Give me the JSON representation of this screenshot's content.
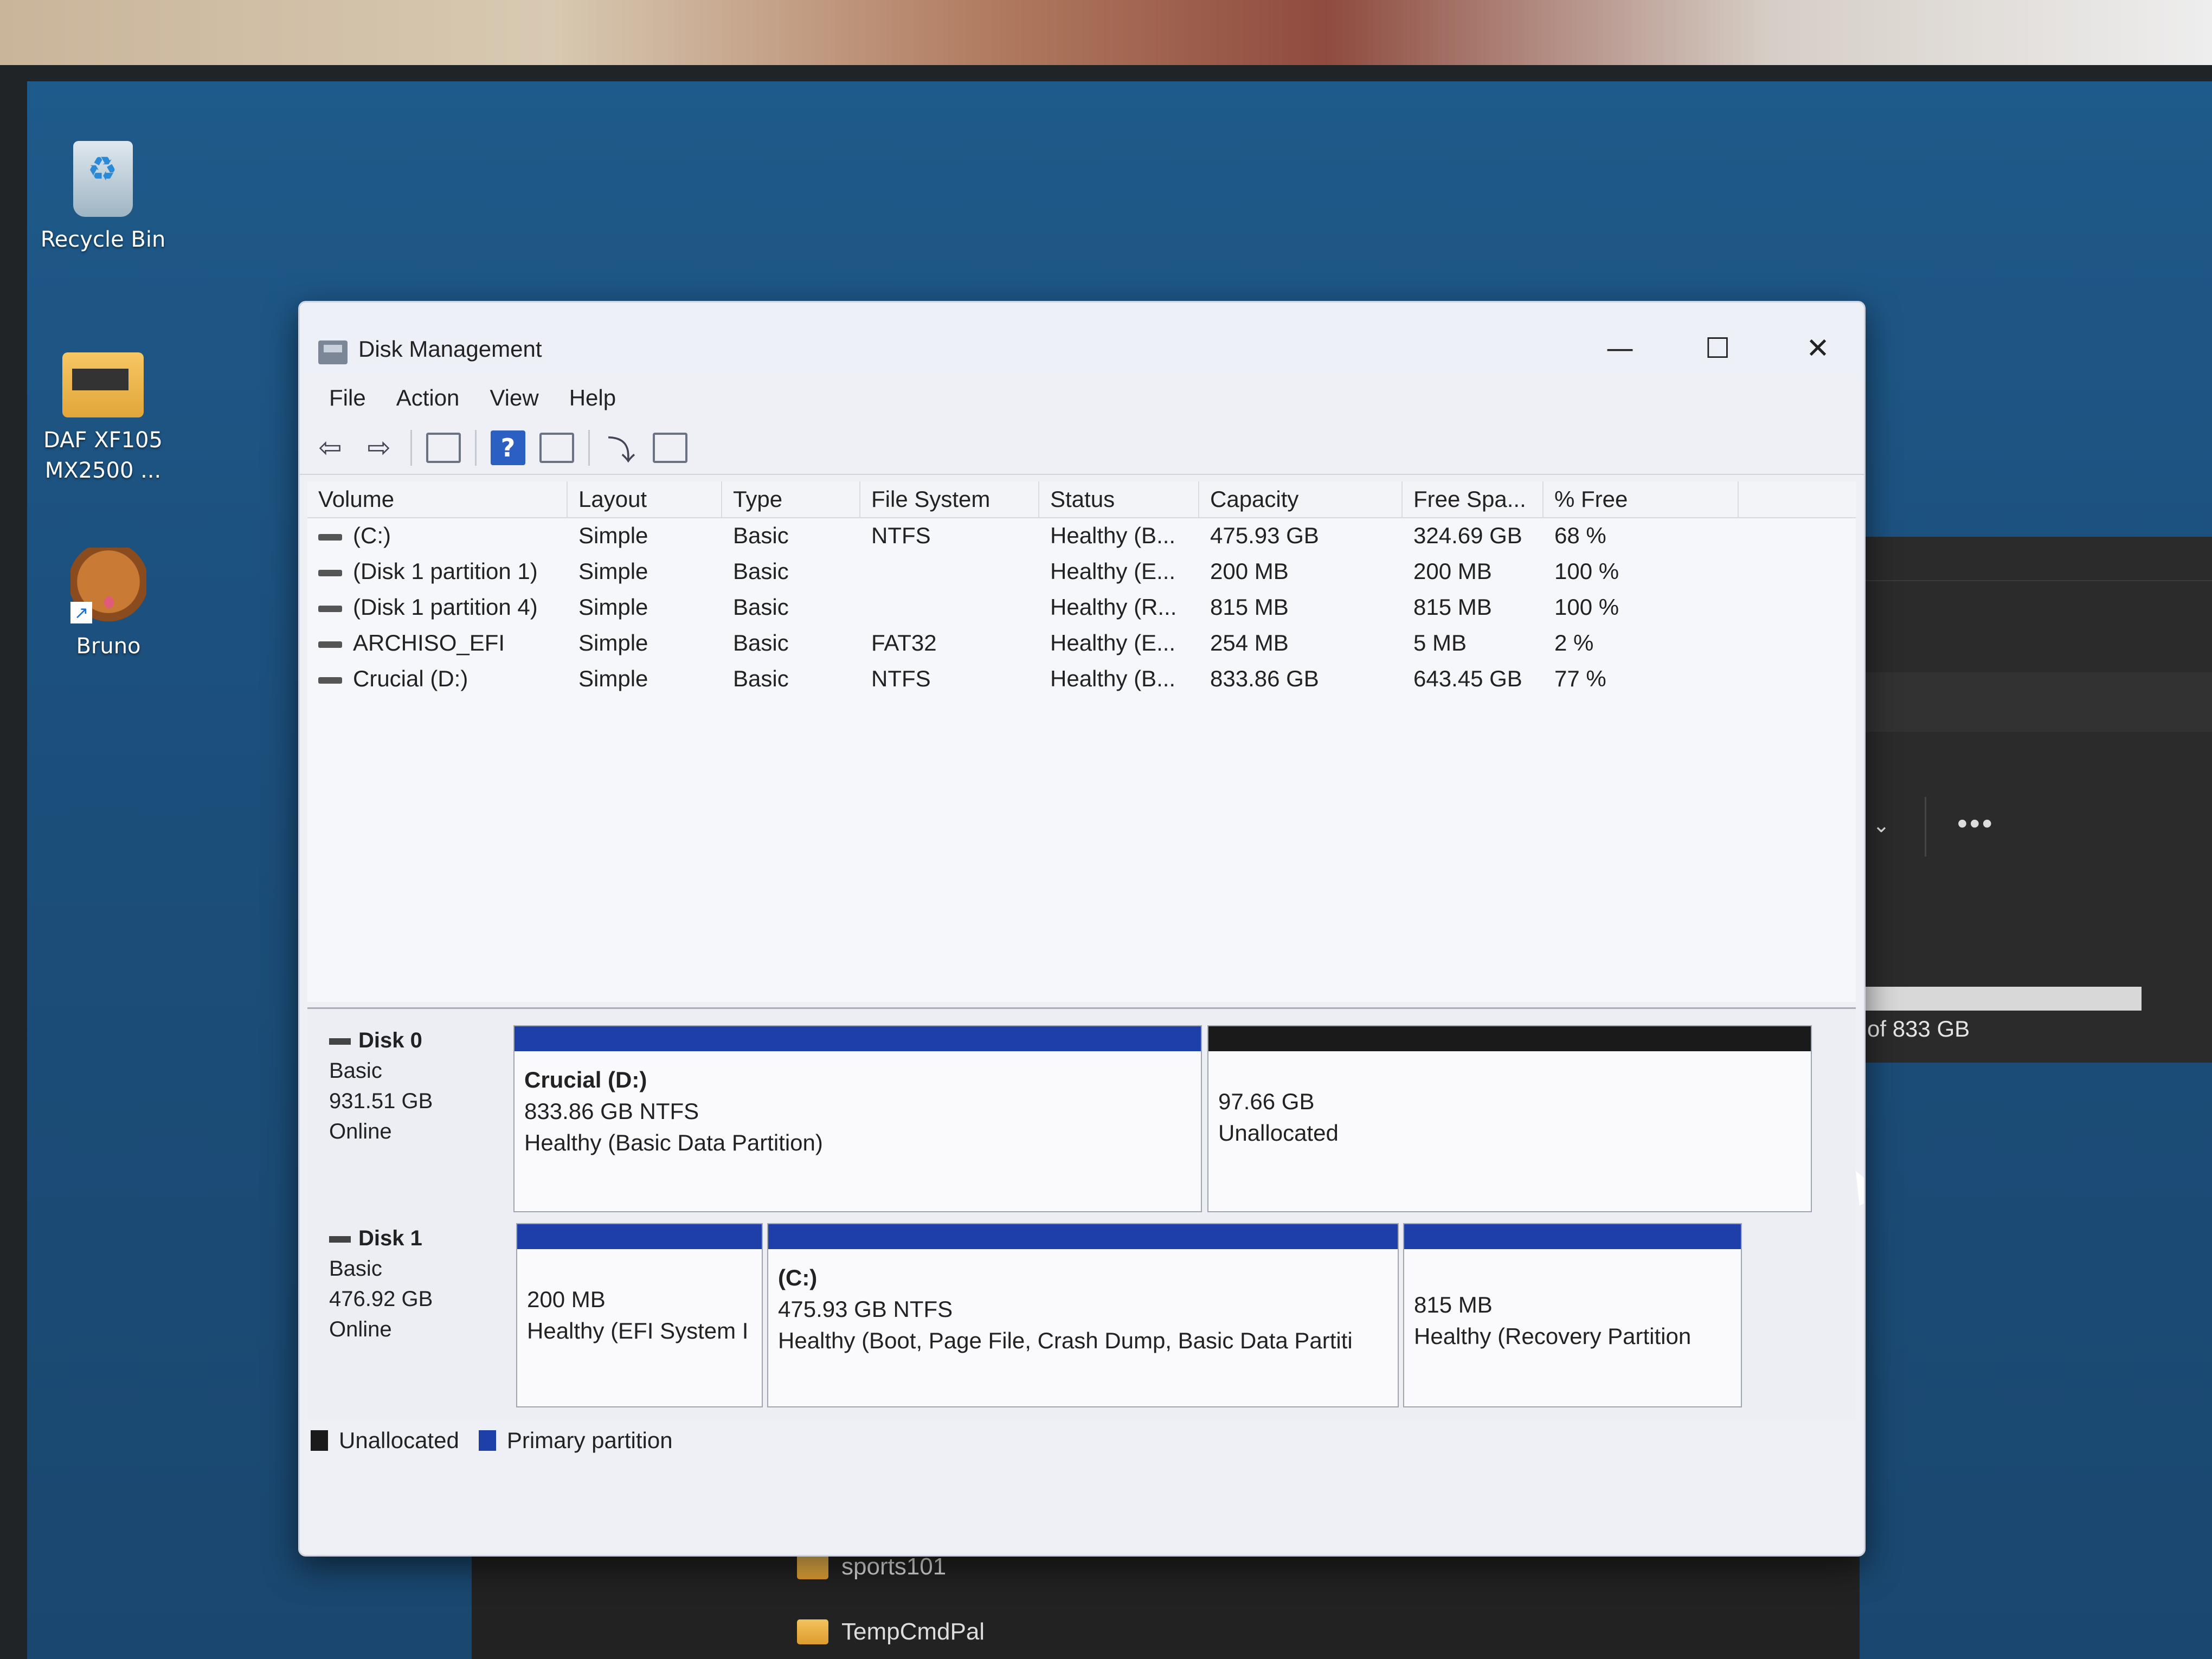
{
  "desktop": {
    "icons": [
      {
        "label": "Recycle Bin",
        "icon": "recycle-bin-icon"
      },
      {
        "label": "DAF XF105\nMX2500 ...",
        "icon": "folder-icon"
      },
      {
        "label": "Bruno",
        "icon": "dog-app-icon"
      }
    ]
  },
  "background_app": {
    "size_text": "of 833 GB",
    "more_label": "•••",
    "chevron": "⌄"
  },
  "explorer_items": [
    {
      "label": "sports101",
      "icon": "folder-icon"
    },
    {
      "label": "TempCmdPal",
      "icon": "folder-icon"
    }
  ],
  "window": {
    "title": "Disk Management",
    "controls": {
      "minimize": "—",
      "maximize": "☐",
      "close": "✕"
    },
    "menu": [
      "File",
      "Action",
      "View",
      "Help"
    ],
    "toolbar": [
      "back-arrow-icon",
      "forward-arrow-icon",
      "console-tree-icon",
      "help-icon",
      "show-hide-icon",
      "rescan-icon",
      "properties-icon"
    ],
    "columns": [
      "Volume",
      "Layout",
      "Type",
      "File System",
      "Status",
      "Capacity",
      "Free Spa...",
      "% Free"
    ],
    "volumes": [
      {
        "volume": "(C:)",
        "layout": "Simple",
        "type": "Basic",
        "fs": "NTFS",
        "status": "Healthy (B...",
        "capacity": "475.93 GB",
        "free": "324.69 GB",
        "pct": "68 %"
      },
      {
        "volume": "(Disk 1 partition 1)",
        "layout": "Simple",
        "type": "Basic",
        "fs": "",
        "status": "Healthy (E...",
        "capacity": "200 MB",
        "free": "200 MB",
        "pct": "100 %"
      },
      {
        "volume": "(Disk 1 partition 4)",
        "layout": "Simple",
        "type": "Basic",
        "fs": "",
        "status": "Healthy (R...",
        "capacity": "815 MB",
        "free": "815 MB",
        "pct": "100 %"
      },
      {
        "volume": "ARCHISO_EFI",
        "layout": "Simple",
        "type": "Basic",
        "fs": "FAT32",
        "status": "Healthy (E...",
        "capacity": "254 MB",
        "free": "5 MB",
        "pct": "2 %"
      },
      {
        "volume": "Crucial (D:)",
        "layout": "Simple",
        "type": "Basic",
        "fs": "NTFS",
        "status": "Healthy (B...",
        "capacity": "833.86 GB",
        "free": "643.45 GB",
        "pct": "77 %"
      }
    ],
    "disks": [
      {
        "name": "Disk 0",
        "type": "Basic",
        "size": "931.51 GB",
        "state": "Online",
        "partitions": [
          {
            "name": "Crucial  (D:)",
            "size": "833.86 GB NTFS",
            "status": "Healthy (Basic Data Partition)",
            "kind": "primary"
          },
          {
            "name": "",
            "size": "97.66 GB",
            "status": "Unallocated",
            "kind": "unallocated"
          }
        ]
      },
      {
        "name": "Disk 1",
        "type": "Basic",
        "size": "476.92 GB",
        "state": "Online",
        "partitions": [
          {
            "name": "",
            "size": "200 MB",
            "status": "Healthy (EFI System I",
            "kind": "primary"
          },
          {
            "name": "(C:)",
            "size": "475.93 GB NTFS",
            "status": "Healthy (Boot, Page File, Crash Dump, Basic Data Partiti",
            "kind": "primary"
          },
          {
            "name": "",
            "size": "815 MB",
            "status": "Healthy (Recovery Partition",
            "kind": "primary"
          }
        ]
      }
    ],
    "legend": [
      {
        "label": "Unallocated",
        "color": "#1a1a1a"
      },
      {
        "label": "Primary partition",
        "color": "#1f3fa8"
      }
    ],
    "colors": {
      "primary_bar": "#1f3fa8",
      "unallocated_bar": "#1a1a1a"
    }
  }
}
